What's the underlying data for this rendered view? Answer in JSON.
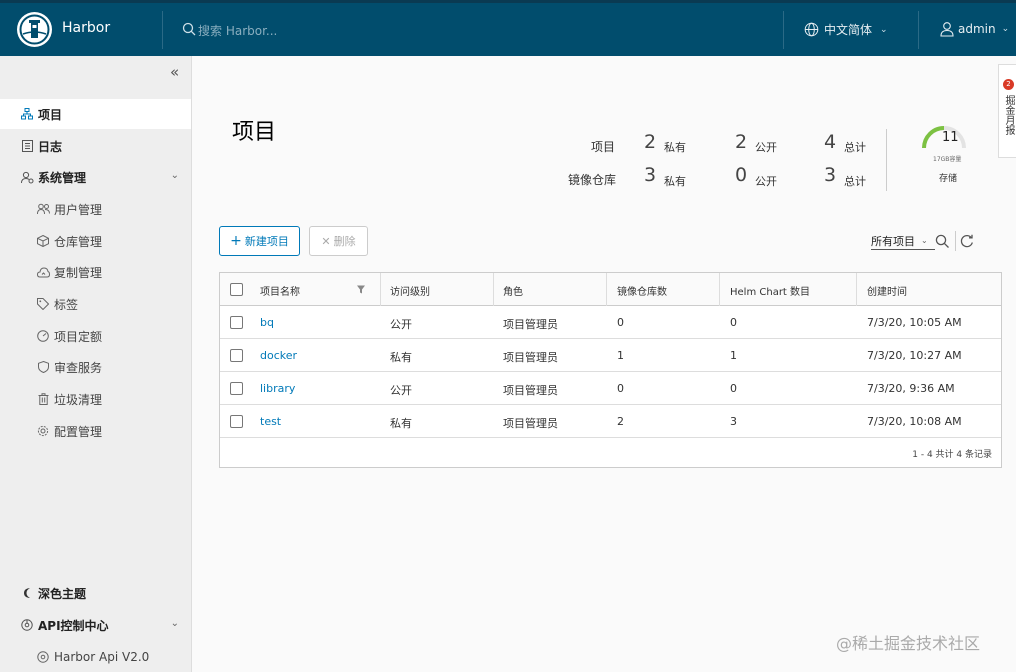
{
  "header": {
    "brand": "Harbor",
    "search_placeholder": "搜索 Harbor...",
    "language": "中文简体",
    "user": "admin"
  },
  "sidebar": {
    "items": [
      {
        "label": "项目",
        "icon": "projects-icon"
      },
      {
        "label": "日志",
        "icon": "logs-icon"
      },
      {
        "label": "系统管理",
        "icon": "admin-icon"
      },
      {
        "label": "用户管理",
        "icon": "users-icon"
      },
      {
        "label": "仓库管理",
        "icon": "registry-icon"
      },
      {
        "label": "复制管理",
        "icon": "replication-icon"
      },
      {
        "label": "标签",
        "icon": "tag-icon"
      },
      {
        "label": "项目定额",
        "icon": "quota-icon"
      },
      {
        "label": "审查服务",
        "icon": "shield-icon"
      },
      {
        "label": "垃圾清理",
        "icon": "trash-icon"
      },
      {
        "label": "配置管理",
        "icon": "gear-icon"
      }
    ],
    "theme": "深色主题",
    "api_center": "API控制中心",
    "api_version": "Harbor Api V2.0"
  },
  "main": {
    "title": "项目",
    "stats": {
      "project_label": "项目",
      "repo_label": "镜像仓库",
      "private_label": "私有",
      "public_label": "公开",
      "total_label": "总计",
      "project_private": "2",
      "project_public": "2",
      "project_total": "4",
      "repo_private": "3",
      "repo_public": "0",
      "repo_total": "3"
    },
    "storage": {
      "value": "11",
      "sub": "17GB容量",
      "label": "存储"
    },
    "buttons": {
      "new_project": "新建项目",
      "delete": "删除"
    },
    "filter": "所有项目",
    "table": {
      "headers": [
        "项目名称",
        "访问级别",
        "角色",
        "镜像仓库数",
        "Helm Chart 数目",
        "创建时间"
      ],
      "rows": [
        {
          "name": "bq",
          "access": "公开",
          "role": "项目管理员",
          "repos": "0",
          "charts": "0",
          "created": "7/3/20, 10:05 AM"
        },
        {
          "name": "docker",
          "access": "私有",
          "role": "项目管理员",
          "repos": "1",
          "charts": "1",
          "created": "7/3/20, 10:27 AM"
        },
        {
          "name": "library",
          "access": "公开",
          "role": "项目管理员",
          "repos": "0",
          "charts": "0",
          "created": "7/3/20, 9:36 AM"
        },
        {
          "name": "test",
          "access": "私有",
          "role": "项目管理员",
          "repos": "2",
          "charts": "3",
          "created": "7/3/20, 10:08 AM"
        }
      ],
      "footer": "1 - 4 共计 4 条记录"
    }
  },
  "side_tab": {
    "badge": "2",
    "text": "掘金月报"
  },
  "watermark": "@稀土掘金技术社区",
  "colors": {
    "header_bg": "#014d6d",
    "link": "#0079b8",
    "gauge": "#7cc142"
  }
}
